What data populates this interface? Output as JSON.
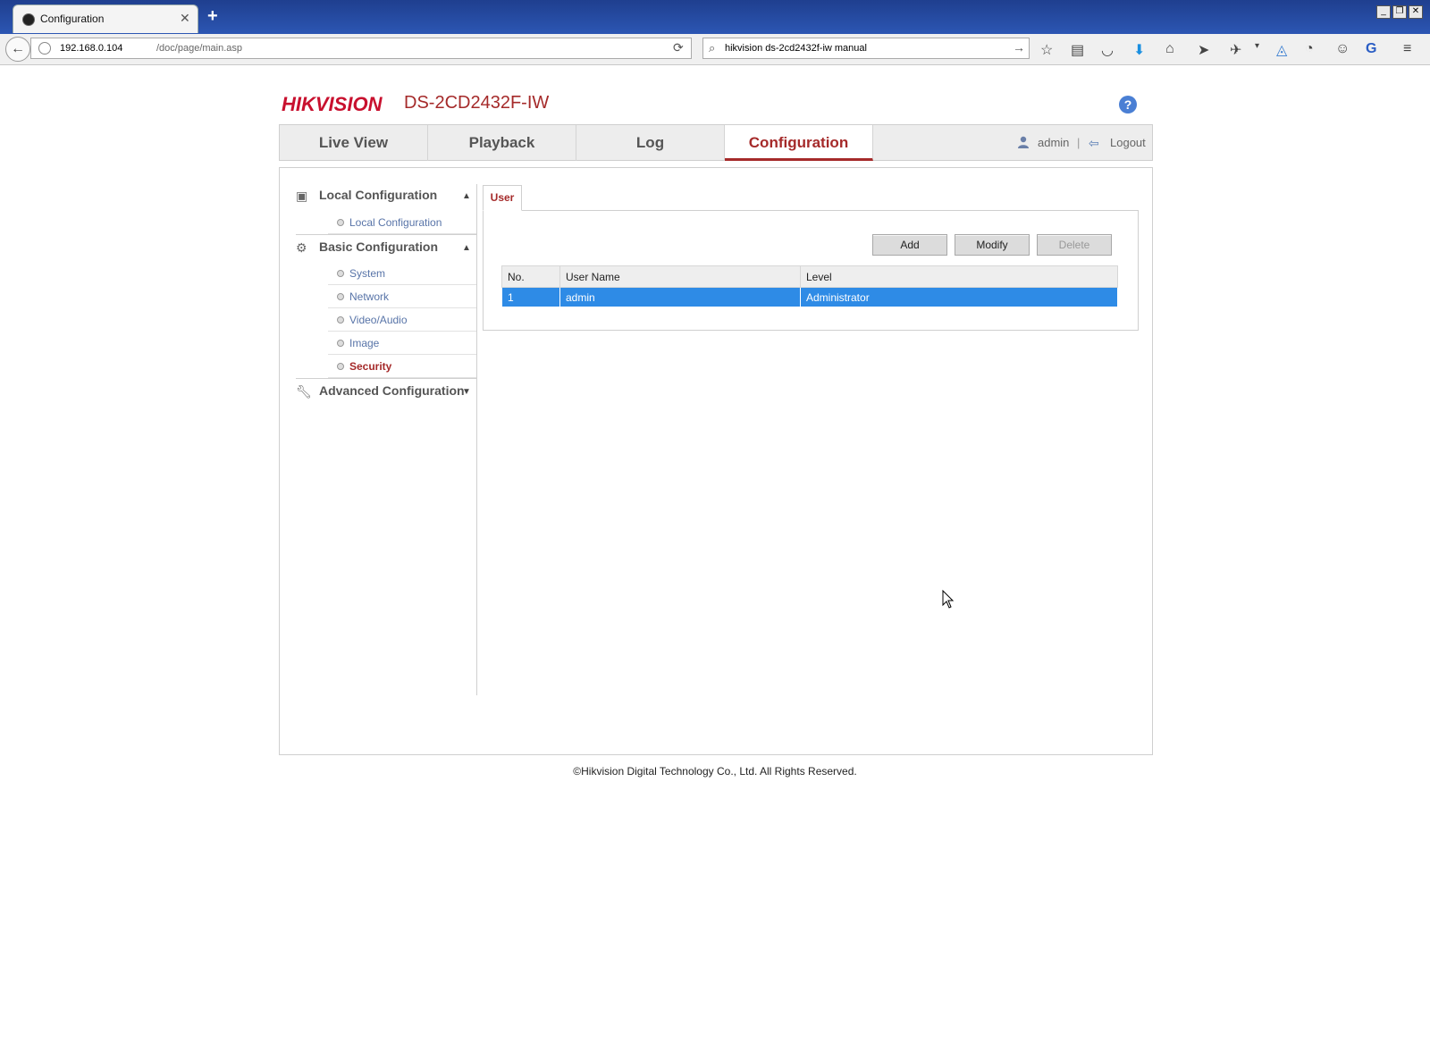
{
  "browser": {
    "tab_title": "Configuration",
    "url_host": "192.168.0.104",
    "url_path": "/doc/page/main.asp",
    "search_text": "hikvision ds-2cd2432f-iw manual"
  },
  "header": {
    "brand": "HIKVISION",
    "model": "DS-2CD2432F-IW"
  },
  "nav": {
    "tabs": [
      {
        "label": "Live View"
      },
      {
        "label": "Playback"
      },
      {
        "label": "Log"
      },
      {
        "label": "Configuration"
      }
    ],
    "active_tab": "Configuration",
    "user": "admin",
    "separator": "|",
    "logout": "Logout"
  },
  "sidebar": {
    "sections": [
      {
        "label": "Local Configuration",
        "items": [
          {
            "label": "Local Configuration"
          }
        ]
      },
      {
        "label": "Basic Configuration",
        "items": [
          {
            "label": "System"
          },
          {
            "label": "Network"
          },
          {
            "label": "Video/Audio"
          },
          {
            "label": "Image"
          },
          {
            "label": "Security"
          }
        ]
      },
      {
        "label": "Advanced Configuration",
        "items": []
      }
    ],
    "active_item": "Security"
  },
  "main": {
    "tab": "User",
    "buttons": {
      "add": "Add",
      "modify": "Modify",
      "delete": "Delete"
    },
    "table": {
      "columns": [
        "No.",
        "User Name",
        "Level"
      ],
      "rows": [
        [
          "1",
          "admin",
          "Administrator"
        ]
      ]
    }
  },
  "footer": "©Hikvision Digital Technology Co., Ltd. All Rights Reserved.",
  "colors": {
    "accent": "#a52a2a",
    "brand_red": "#c8102e",
    "selection_blue": "#2e8be6",
    "titlebar_blue": "#2c56b3"
  },
  "icons": [
    "back-icon",
    "reload-icon",
    "search-icon",
    "bookmark-star-icon",
    "help-icon",
    "user-icon",
    "logout-icon",
    "local-config-icon",
    "gear-icon",
    "wrench-icon"
  ]
}
